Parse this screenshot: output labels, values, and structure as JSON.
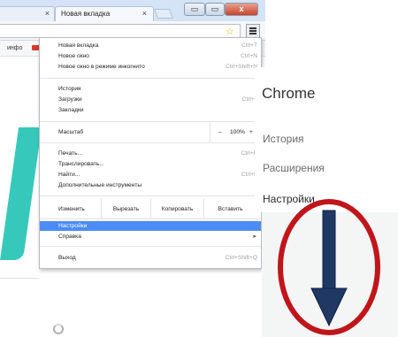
{
  "browser": {
    "tabs": [
      {
        "label": ""
      },
      {
        "label": "Новая вкладка"
      }
    ],
    "tab_close_glyph": "×",
    "bookmark_fragment": "инфо",
    "window_buttons": {
      "minimize": "▭",
      "maximize": "▭",
      "close": "x"
    }
  },
  "menu": {
    "group1": [
      {
        "label": "Новая вкладка",
        "shortcut": "Ctrl+T"
      },
      {
        "label": "Новое окно",
        "shortcut": "Ctrl+N"
      },
      {
        "label": "Новое окно в режиме инкогнито",
        "shortcut": "Ctrl+Shift+N"
      }
    ],
    "group2": [
      {
        "label": "История",
        "shortcut": ""
      },
      {
        "label": "Загрузки",
        "shortcut": "Ctrl+J"
      },
      {
        "label": "Закладки",
        "shortcut": ""
      }
    ],
    "zoom": {
      "label": "Масштаб",
      "minus": "–",
      "value": "100%",
      "plus": "+"
    },
    "group3": [
      {
        "label": "Печать...",
        "shortcut": "Ctrl+P"
      },
      {
        "label": "Транслировать...",
        "shortcut": ""
      },
      {
        "label": "Найти...",
        "shortcut": "Ctrl+F"
      },
      {
        "label": "Дополнительные инструменты",
        "shortcut": ""
      }
    ],
    "edit": {
      "label": "Изменить",
      "cut": "Вырезать",
      "copy": "Копировать",
      "paste": "Вставить"
    },
    "settings": {
      "label": "Настройки"
    },
    "help": {
      "label": "Справка"
    },
    "exit": {
      "label": "Выход",
      "shortcut": "Ctrl+Shift+Q"
    }
  },
  "settings_panel": {
    "title": "Chrome",
    "items": [
      {
        "label": "История"
      },
      {
        "label": "Расширения"
      },
      {
        "label": "Настройки"
      }
    ]
  },
  "annotation": {
    "circle_color": "#c0151b",
    "arrow_color": "#1f3864"
  }
}
